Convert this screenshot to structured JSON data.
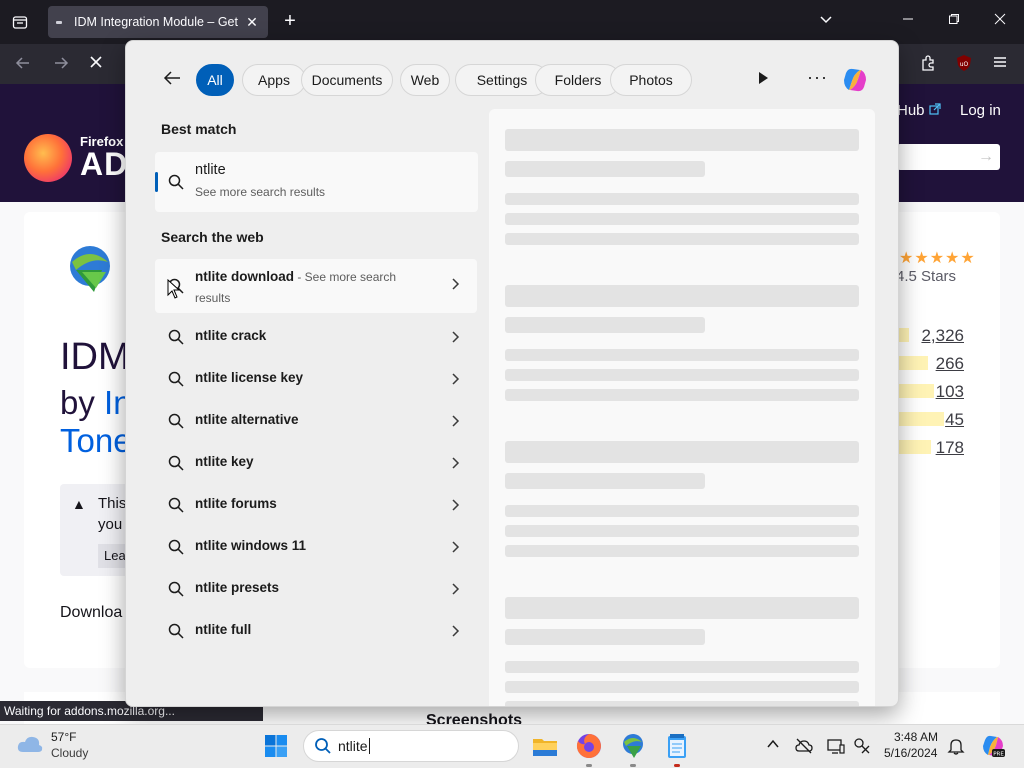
{
  "browser": {
    "tab_title": "IDM Integration Module – Get",
    "tab_close": "✕",
    "new_tab": "+",
    "status_text": "Waiting for addons.mozilla.org..."
  },
  "site": {
    "logo_small": "Firefox",
    "logo_big": "AD",
    "hub_link": "Hub",
    "login_link": "Log in",
    "addon_title": "IDM",
    "addon_by": "by",
    "addon_by_link": "In",
    "addon_author_line2": "Tone",
    "notice_line1": "This",
    "notice_line2": "you",
    "notice_button": "Lea",
    "download_text": "Downloa",
    "stars_label": "4.5 Stars",
    "ratings": [
      {
        "count": "2,326",
        "fill": 0.08
      },
      {
        "count": "266",
        "fill": 0.2
      },
      {
        "count": "103",
        "fill": 0.24
      },
      {
        "count": "45",
        "fill": 0.3
      },
      {
        "count": "178",
        "fill": 0.22
      }
    ],
    "screenshots_title": "Screenshots"
  },
  "flyout": {
    "filters": [
      "All",
      "Apps",
      "Documents",
      "Web",
      "Settings",
      "Folders",
      "Photos"
    ],
    "active_filter": "All",
    "more_label": "···",
    "best_match_label": "Best match",
    "best_match": {
      "query": "ntlite",
      "subtitle": "See more search results"
    },
    "search_web_label": "Search the web",
    "web_first": {
      "query": "ntlite download",
      "hint": " - See more search",
      "hint2": "results"
    },
    "web_items": [
      "ntlite crack",
      "ntlite license key",
      "ntlite alternative",
      "ntlite key",
      "ntlite forums",
      "ntlite windows 11",
      "ntlite presets",
      "ntlite full"
    ]
  },
  "taskbar": {
    "weather_temp": "57°F",
    "weather_desc": "Cloudy",
    "search_value": "ntlite",
    "time": "3:48 AM",
    "date": "5/16/2024"
  },
  "colors": {
    "accent": "#005fb8",
    "page_header": "#20123a",
    "link": "#0060df"
  }
}
